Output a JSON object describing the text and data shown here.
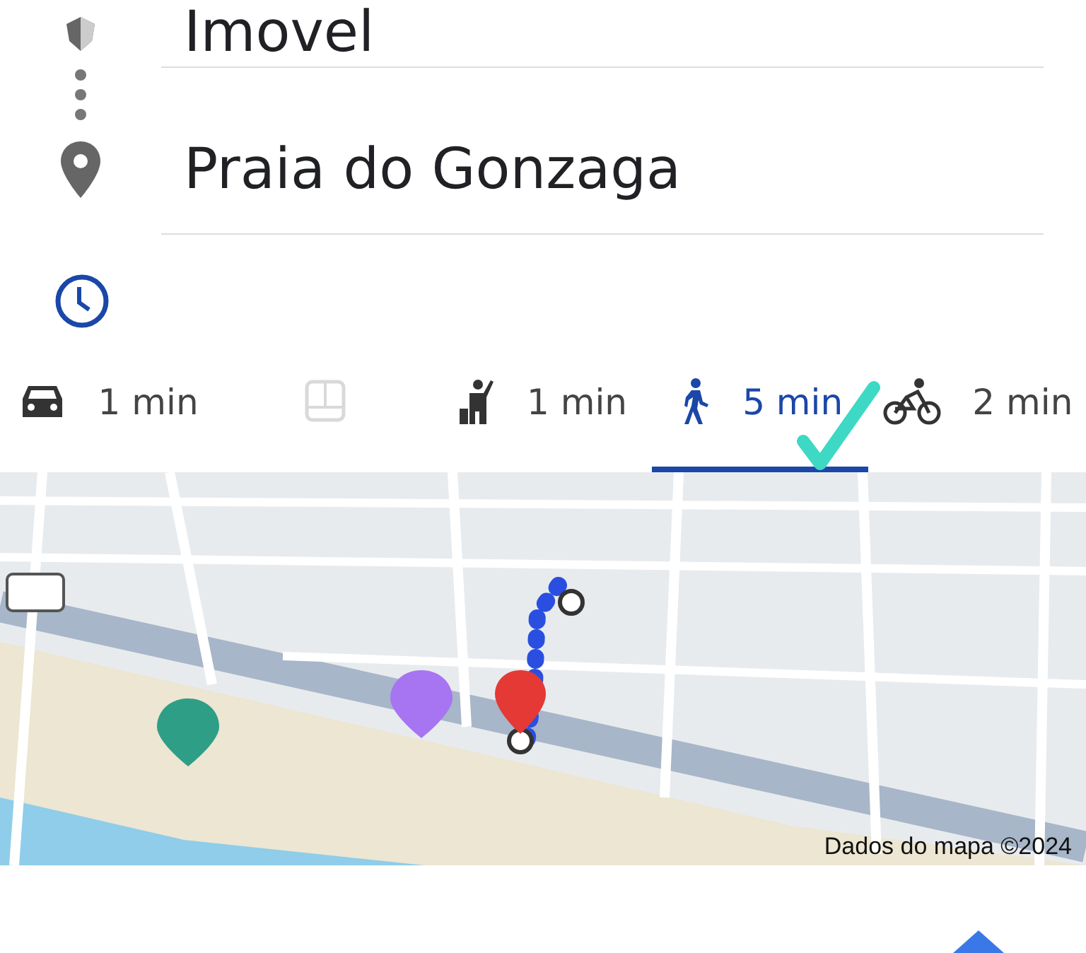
{
  "origin": {
    "value": "Imovel"
  },
  "destination": {
    "value": "Praia do Gonzaga"
  },
  "modes": [
    {
      "kind": "car",
      "label": "1 min",
      "selected": false,
      "disabled": false
    },
    {
      "kind": "transit",
      "selected": false,
      "disabled": true
    },
    {
      "kind": "ride",
      "label": "1 min",
      "selected": false,
      "disabled": false
    },
    {
      "kind": "walk",
      "label": "5 min",
      "selected": true,
      "disabled": false
    },
    {
      "kind": "bike",
      "label": "2 min",
      "selected": false,
      "disabled": false
    }
  ],
  "map": {
    "attribution": "Dados do mapa ©2024"
  }
}
